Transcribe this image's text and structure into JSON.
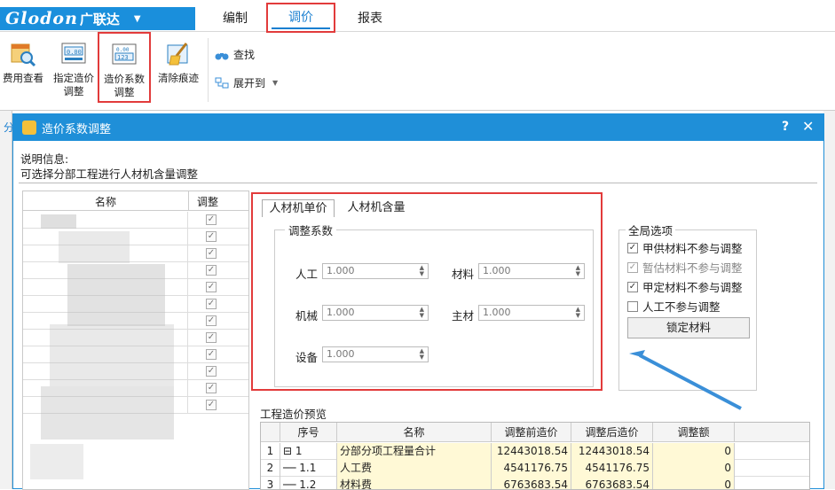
{
  "app": {
    "logo": "Glodon",
    "brand_cn": "广联达",
    "menu_arrow": "▼"
  },
  "menu_tabs": [
    {
      "label": "编制"
    },
    {
      "label": "调价"
    },
    {
      "label": "报表"
    }
  ],
  "ribbon": {
    "buttons": [
      {
        "label": "费用查看"
      },
      {
        "label": "指定造价\n调整"
      },
      {
        "label": "造价系数\n调整"
      },
      {
        "label": "清除痕迹"
      }
    ],
    "small": [
      {
        "label": "查找"
      },
      {
        "label": "展开到"
      }
    ]
  },
  "left_strip_label": "分",
  "dialog": {
    "title": "造价系数调整",
    "help": "?",
    "close": "✕",
    "info_label": "说明信息:",
    "info_text": "可选择分部工程进行人材机含量调整",
    "left_table": {
      "headers": [
        "名称",
        "调整"
      ],
      "checked_mark": "☑"
    },
    "tabs": [
      {
        "label": "人材机单价"
      },
      {
        "label": "人材机含量"
      }
    ],
    "coef": {
      "group_label": "调整系数",
      "fields": [
        {
          "label": "人工",
          "value": "1.000"
        },
        {
          "label": "材料",
          "value": "1.000"
        },
        {
          "label": "机械",
          "value": "1.000"
        },
        {
          "label": "主材",
          "value": "1.000"
        },
        {
          "label": "设备",
          "value": "1.000"
        }
      ]
    },
    "global": {
      "group_label": "全局选项",
      "options": [
        {
          "label": "甲供材料不参与调整",
          "checked": true
        },
        {
          "label": "暂估材料不参与调整",
          "checked": true
        },
        {
          "label": "甲定材料不参与调整",
          "checked": true
        },
        {
          "label": "人工不参与调整",
          "checked": false
        }
      ],
      "lock_button": "锁定材料"
    },
    "preview": {
      "label": "工程造价预览",
      "headers": [
        "",
        "序号",
        "名称",
        "调整前造价",
        "调整后造价",
        "调整额"
      ],
      "rows": [
        {
          "n": "1",
          "seq": "1",
          "name": "分部分项工程量合计",
          "before": "12443018.54",
          "after": "12443018.54",
          "diff": "0"
        },
        {
          "n": "2",
          "seq": "1.1",
          "name": "人工费",
          "before": "4541176.75",
          "after": "4541176.75",
          "diff": "0"
        },
        {
          "n": "3",
          "seq": "1.2",
          "name": "材料费",
          "before": "6763683.54",
          "after": "6763683.54",
          "diff": "0"
        }
      ]
    }
  }
}
